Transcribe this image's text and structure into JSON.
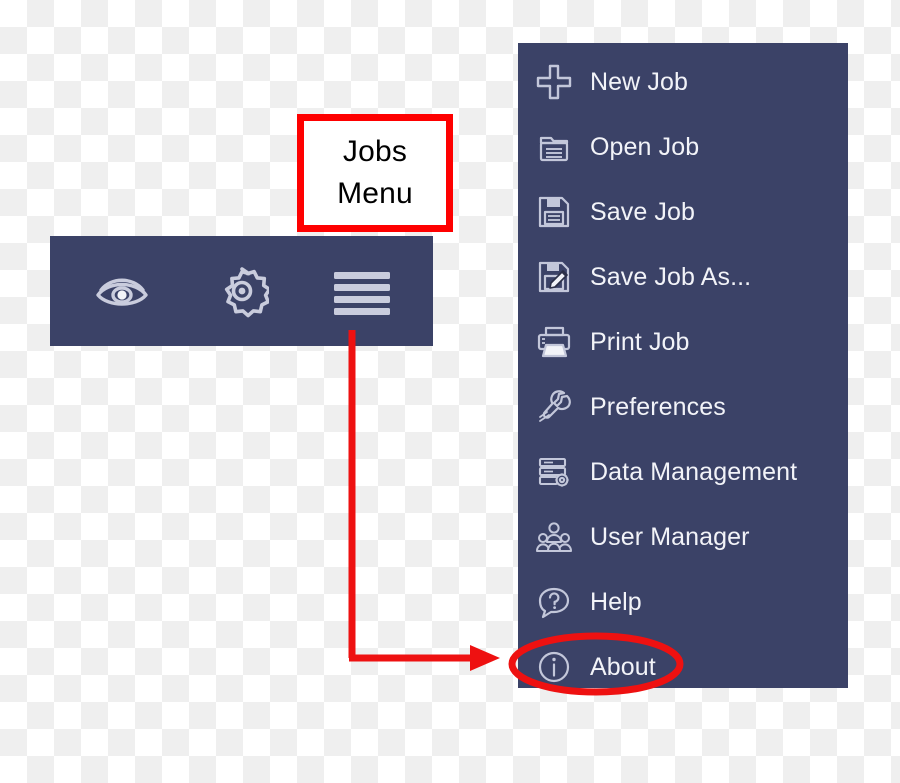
{
  "callout": {
    "line1": "Jobs",
    "line2": "Menu",
    "border_color": "#fe0000",
    "text_color": "#000000"
  },
  "toolbar": {
    "background_color": "#3b4267",
    "buttons": [
      {
        "name": "eye-icon",
        "label": "View",
        "icon": "eye-icon"
      },
      {
        "name": "gear-icon",
        "label": "Settings",
        "icon": "gear-icon"
      },
      {
        "name": "hamburger-icon",
        "label": "Jobs Menu",
        "icon": "hamburger-menu-icon"
      }
    ]
  },
  "menu": {
    "background_color": "#3b4267",
    "text_color": "#f2f3f8",
    "items": [
      {
        "label": "New Job",
        "icon": "plus-icon"
      },
      {
        "label": "Open Job",
        "icon": "folder-open-icon"
      },
      {
        "label": "Save Job",
        "icon": "floppy-disk-icon"
      },
      {
        "label": "Save Job As...",
        "icon": "floppy-disk-pencil-icon"
      },
      {
        "label": "Print Job",
        "icon": "printer-icon"
      },
      {
        "label": "Preferences",
        "icon": "wrench-icon"
      },
      {
        "label": "Data Management",
        "icon": "database-gear-icon"
      },
      {
        "label": "User Manager",
        "icon": "users-group-icon"
      },
      {
        "label": "Help",
        "icon": "question-speech-bubble-icon"
      },
      {
        "label": "About",
        "icon": "info-circle-icon"
      }
    ]
  },
  "annotation": {
    "color": "#ee1111",
    "highlighted_item": "About",
    "arrow_from": "hamburger-icon",
    "arrow_to": "About"
  }
}
